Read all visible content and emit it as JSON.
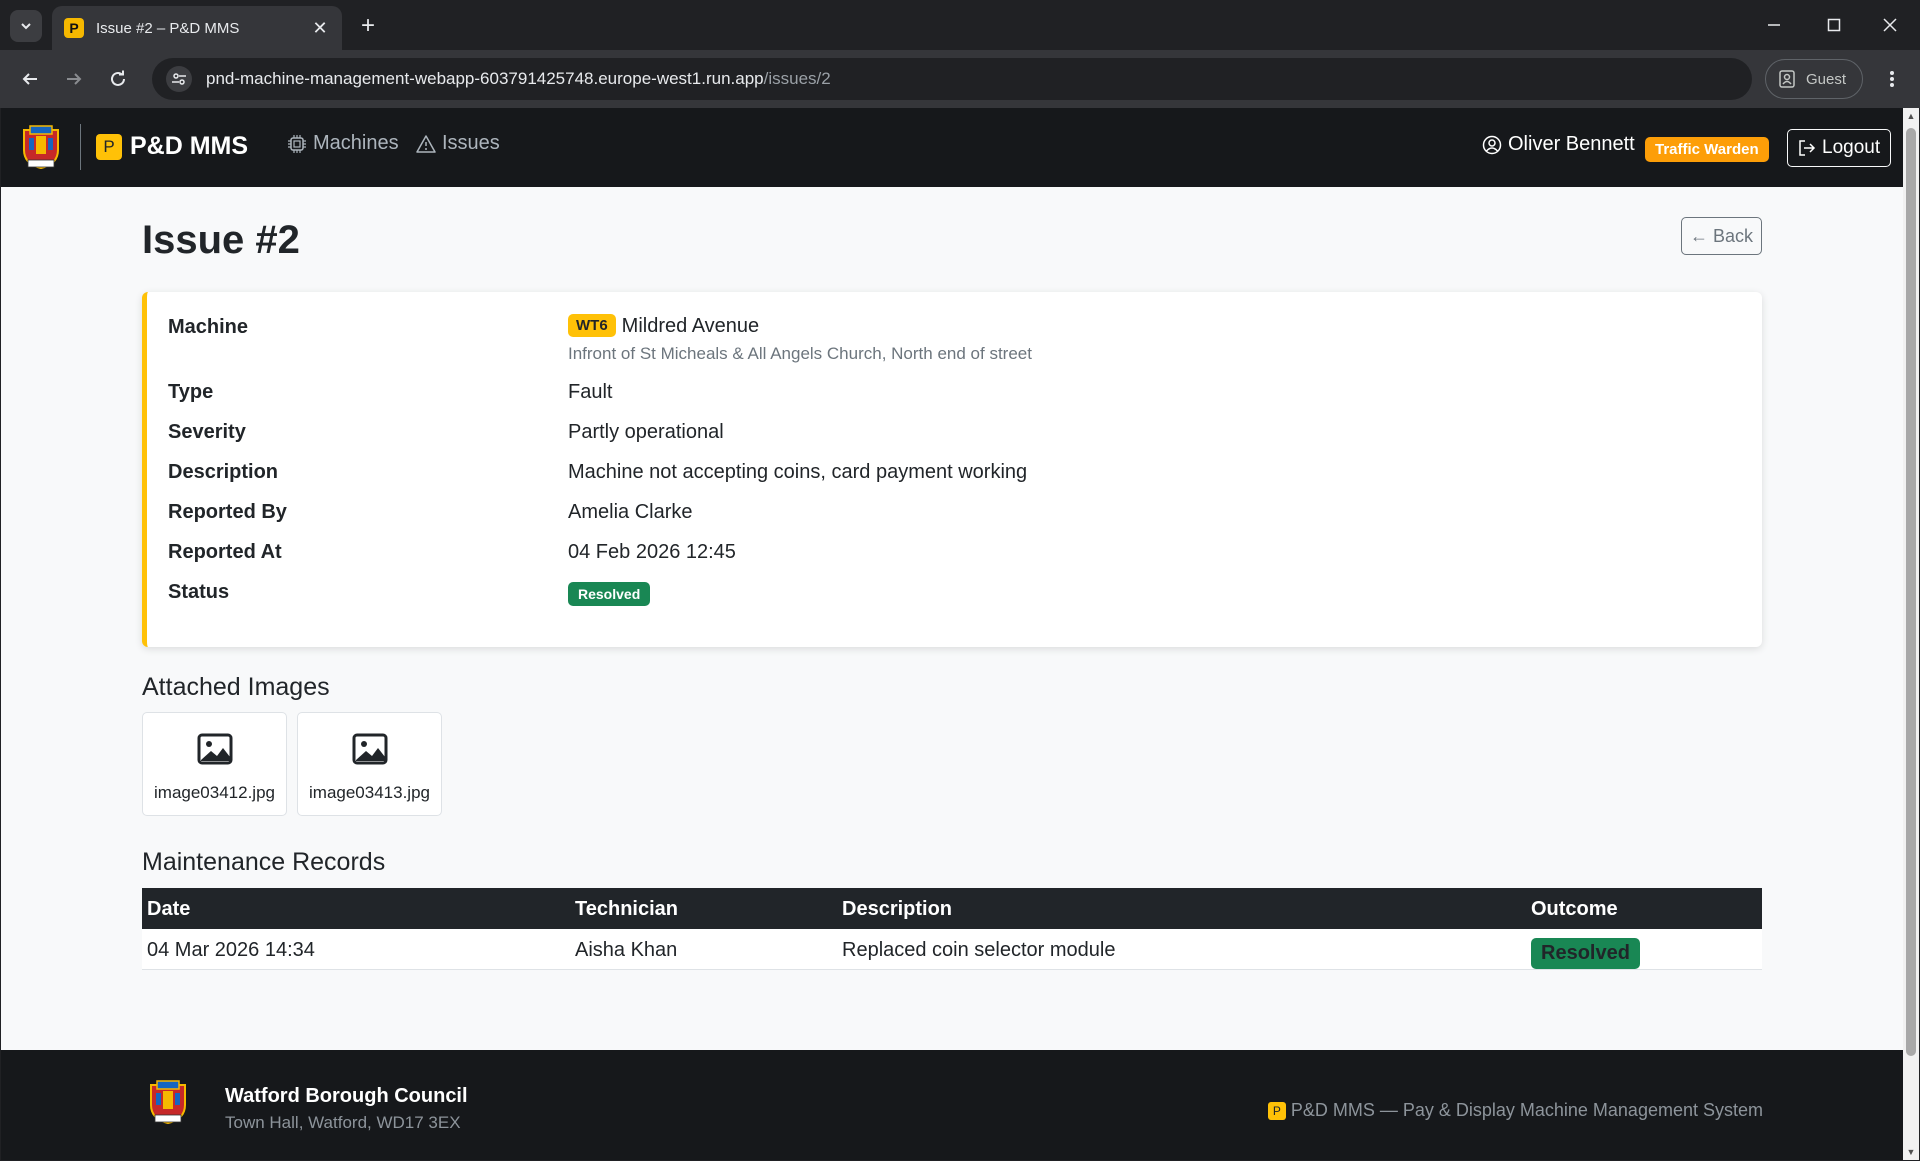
{
  "browser": {
    "tab_title": "Issue #2 – P&D MMS",
    "tab_favicon": "P",
    "url_main": "pnd-machine-management-webapp-603791425748.europe-west1.run.app",
    "url_path": "/issues/2",
    "profile_label": "Guest"
  },
  "navbar": {
    "brand": "P&D MMS",
    "brand_icon": "P",
    "links": [
      {
        "label": "Machines",
        "icon": "chip-icon"
      },
      {
        "label": "Issues",
        "icon": "warning-triangle-icon"
      }
    ],
    "user_name": "Oliver Bennett",
    "role": "Traffic Warden",
    "logout_label": "Logout"
  },
  "page": {
    "title": "Issue #2",
    "back_label": "← Back"
  },
  "issue": {
    "labels": {
      "machine": "Machine",
      "type": "Type",
      "severity": "Severity",
      "description": "Description",
      "reported_by": "Reported By",
      "reported_at": "Reported At",
      "status": "Status"
    },
    "machine_code": "WT6",
    "machine_name": "Mildred Avenue",
    "machine_location": "Infront of St Micheals & All Angels Church, North end of street",
    "type": "Fault",
    "severity": "Partly operational",
    "description": "Machine not accepting coins, card payment working",
    "reported_by": "Amelia Clarke",
    "reported_at": "04 Feb 2026 12:45",
    "status": "Resolved"
  },
  "attachments": {
    "heading": "Attached Images",
    "files": [
      "image03412.jpg",
      "image03413.jpg"
    ]
  },
  "maintenance": {
    "heading": "Maintenance Records",
    "columns": [
      "Date",
      "Technician",
      "Description",
      "Outcome"
    ],
    "rows": [
      {
        "date": "04 Mar 2026 14:34",
        "technician": "Aisha Khan",
        "description": "Replaced coin selector module",
        "outcome": "Resolved"
      }
    ]
  },
  "footer": {
    "org": "Watford Borough Council",
    "address": "Town Hall, Watford, WD17 3EX",
    "tagline": "P&D MMS — Pay & Display Machine Management System",
    "tagline_icon": "P"
  },
  "colors": {
    "accent": "#ffc107",
    "role_badge": "#fd9e08",
    "success": "#198754",
    "navbar": "#16181b"
  }
}
